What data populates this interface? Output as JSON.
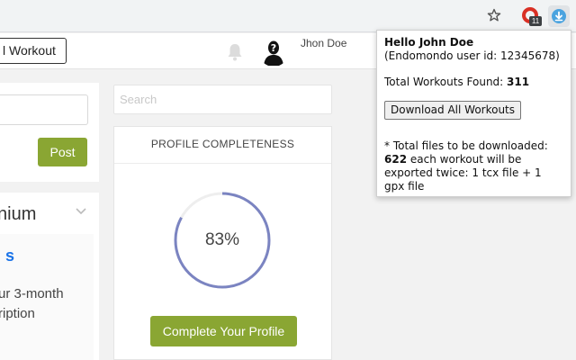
{
  "browser": {
    "icons": [
      "star-icon",
      "extension-icon",
      "download-extension-icon"
    ],
    "extension_badge": "11"
  },
  "header": {
    "workout_button_label": "l Workout",
    "user_name": "Jhon Doe"
  },
  "left": {
    "post_label": "Post",
    "premium_title": "nium",
    "premium_link": "s",
    "premium_text": "ur 3-month ription"
  },
  "middle": {
    "search_placeholder": "Search",
    "profile_title": "PROFILE COMPLETENESS",
    "progress_percent": 83,
    "progress_label": "83%",
    "complete_button": "Complete Your Profile"
  },
  "popup": {
    "greeting": "Hello John Doe",
    "user_id_line": "(Endomondo user id: 12345678)",
    "total_label": "Total Workouts Found: ",
    "total_value": "311",
    "download_button": "Download All Workouts",
    "note_prefix": "* Total files to be downloaded: ",
    "note_value": "622",
    "note_suffix": " each workout will be exported twice: 1 tcx file + 1 gpx file"
  },
  "colors": {
    "accent_green": "#8aa633",
    "progress_ring": "#7b84c1",
    "link_blue": "#1a73e8",
    "extension_red": "#d93025"
  }
}
